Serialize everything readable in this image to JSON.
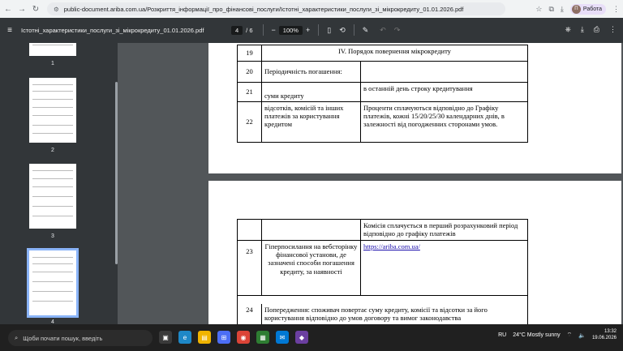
{
  "browser": {
    "url": "public-document.ariba.com.ua/Розкриття_інформації_про_фінансові_послуги/Істотні_характеристики_послуги_зі_мікрокредиту_01.01.2026.pdf",
    "profile_label": "Работа",
    "profile_initial": "П"
  },
  "pdf_toolbar": {
    "title": "Істотні_характеристики_послуги_зі_мікрокредиту_01.01.2026.pdf",
    "page_current": "4",
    "page_total": "/ 6",
    "zoom": "100%"
  },
  "thumbnails": [
    "1",
    "2",
    "3",
    "4"
  ],
  "page1_rows": [
    {
      "num": "19",
      "text": "IV. Порядок повернення мікрокредиту"
    },
    {
      "num": "20",
      "label": "Періодичність погашення:",
      "value": ""
    },
    {
      "num": "21",
      "label": "суми кредиту",
      "value": "в останній день строку кредитування"
    },
    {
      "num": "22",
      "label": "відсотків, комісій та інших платежів за користування кредитом",
      "value": "Проценти сплачуються відповідно до Графіку платежів, кожні 15/20/25/30 календарних днів, в залежності від погодженних сторонами умов."
    }
  ],
  "page2_rows": [
    {
      "num": "",
      "label": "",
      "value": "Комісія сплачується в перший розрахунковий період відповідно до графіку платежів"
    },
    {
      "num": "23",
      "label": "Гіперпосилання на вебсторінку фінансової установи, де зазначені способи погашення кредиту, за наявності",
      "value": "https://ariba.com.ua/"
    },
    {
      "num": "24",
      "text": "Попередження: споживач повертає суму кредиту, комісії та відсотки за його користування відповідно до умов договору та вимог законодавства"
    }
  ],
  "taskbar": {
    "search_placeholder": "Щоби почати пошук, введіть",
    "language": "RU",
    "weather": "24°C  Mostly sunny",
    "time": "13:32",
    "date": "19.06.2026"
  }
}
